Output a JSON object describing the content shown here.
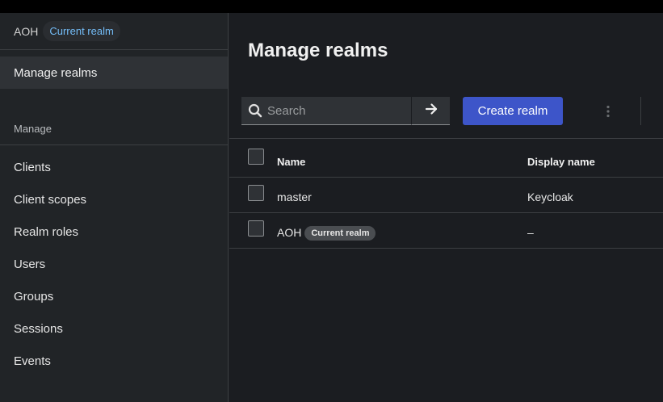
{
  "sidebar": {
    "realm_name": "AOH",
    "realm_badge": "Current realm",
    "active_item": "Manage realms",
    "section_title": "Manage",
    "items": [
      {
        "label": "Clients"
      },
      {
        "label": "Client scopes"
      },
      {
        "label": "Realm roles"
      },
      {
        "label": "Users"
      },
      {
        "label": "Groups"
      },
      {
        "label": "Sessions"
      },
      {
        "label": "Events"
      }
    ]
  },
  "main": {
    "title": "Manage realms",
    "search_placeholder": "Search",
    "create_label": "Create realm"
  },
  "table": {
    "columns": [
      "Name",
      "Display name"
    ],
    "rows": [
      {
        "name": "master",
        "display": "Keycloak"
      },
      {
        "name": "AOH",
        "badge": "Current realm",
        "display": "–"
      }
    ]
  },
  "colors": {
    "accent": "#3d55c9",
    "link": "#73bcf7",
    "background": "#1b1d21",
    "sidebar": "#212427"
  }
}
